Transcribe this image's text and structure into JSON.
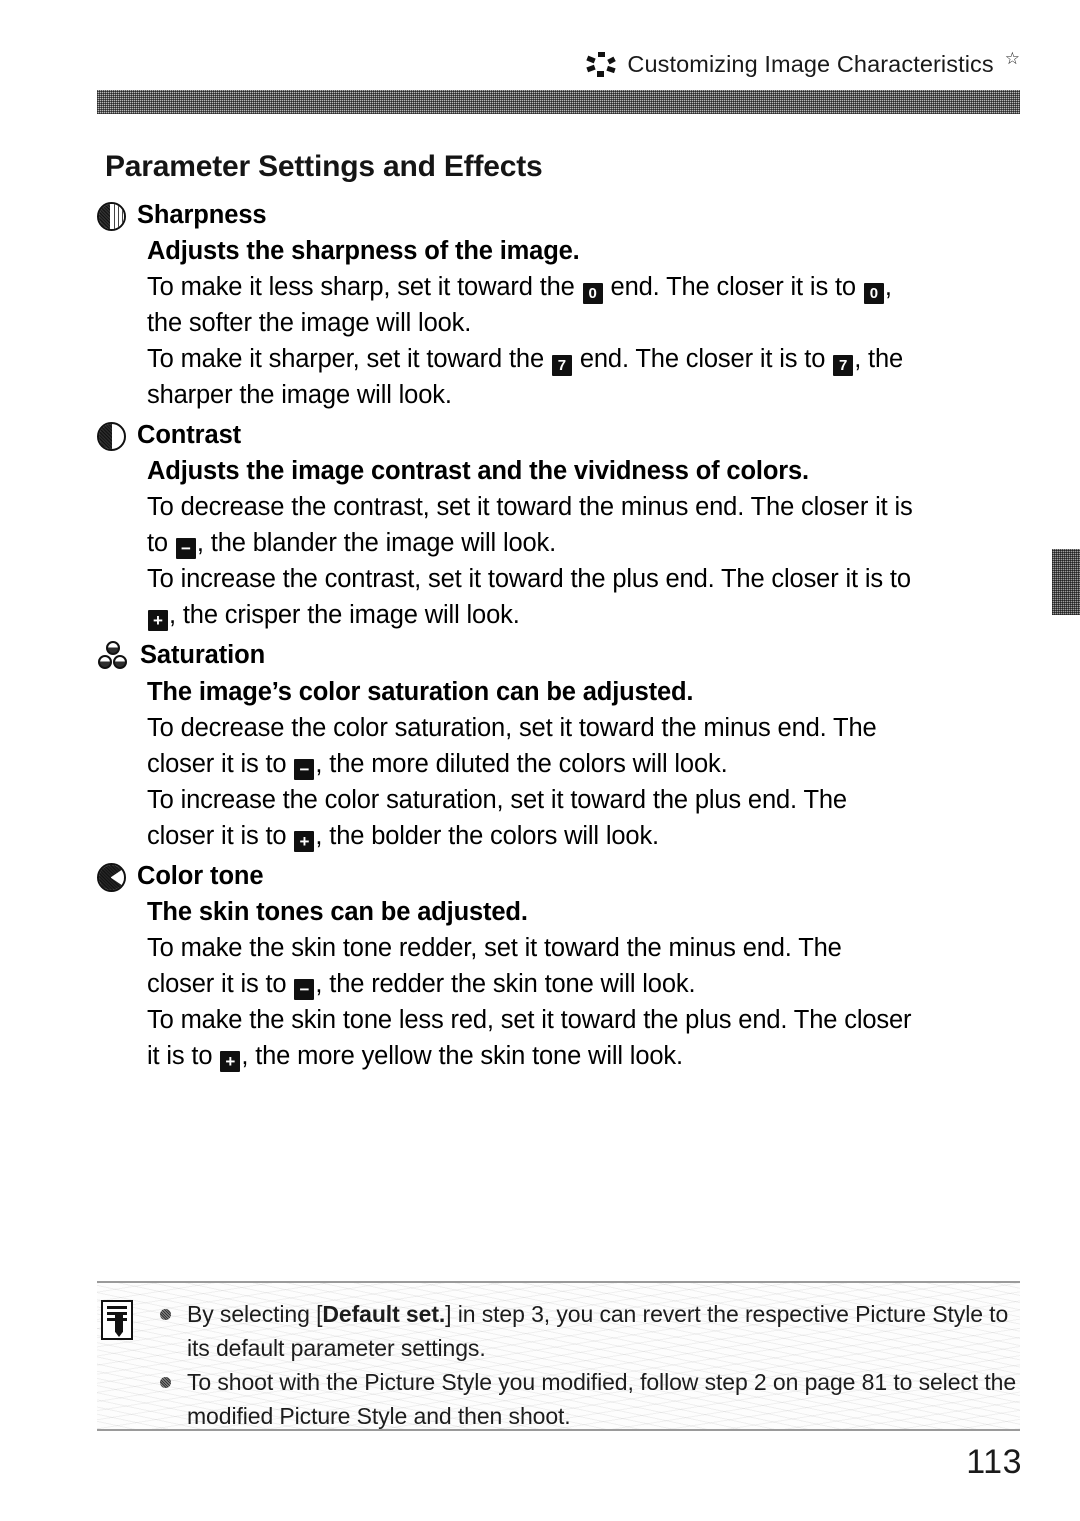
{
  "header": {
    "icon": "picture-style-icon",
    "title": "Customizing Image Characteristics",
    "star": "☆"
  },
  "page": {
    "section_title": "Parameter Settings and Effects",
    "number": "113"
  },
  "glyphs": {
    "zero": "0",
    "seven": "7",
    "minus": "−",
    "plus": "+"
  },
  "parameters": [
    {
      "icon": "sharpness-icon",
      "name": "Sharpness",
      "subtitle": "Adjusts the sharpness of the image.",
      "lines": [
        {
          "parts": [
            {
              "t": "To make it less sharp, set it toward the "
            },
            {
              "k": "0"
            },
            {
              "t": " end. The closer it is to "
            },
            {
              "k": "0"
            },
            {
              "t": ","
            }
          ]
        },
        {
          "parts": [
            {
              "t": "the softer the image will look."
            }
          ]
        },
        {
          "parts": [
            {
              "t": "To make it sharper, set it toward the "
            },
            {
              "k": "7"
            },
            {
              "t": " end. The closer it is to "
            },
            {
              "k": "7"
            },
            {
              "t": ", the"
            }
          ]
        },
        {
          "parts": [
            {
              "t": "sharper the image will look."
            }
          ]
        }
      ]
    },
    {
      "icon": "contrast-icon",
      "name": "Contrast",
      "subtitle": "Adjusts the image contrast and the vividness of colors.",
      "lines": [
        {
          "parts": [
            {
              "t": "To decrease the contrast, set it toward the minus end. The closer it is"
            }
          ]
        },
        {
          "parts": [
            {
              "t": "to "
            },
            {
              "k": "−"
            },
            {
              "t": ", the blander the image will look."
            }
          ]
        },
        {
          "parts": [
            {
              "t": "To increase the contrast, set it toward the plus end. The closer it is to"
            }
          ]
        },
        {
          "parts": [
            {
              "k": "+"
            },
            {
              "t": ", the crisper the image will look."
            }
          ]
        }
      ]
    },
    {
      "icon": "saturation-icon",
      "name": "Saturation",
      "subtitle": "The image’s color saturation can be adjusted.",
      "lines": [
        {
          "parts": [
            {
              "t": "To decrease the color saturation, set it toward the minus end. The"
            }
          ]
        },
        {
          "parts": [
            {
              "t": "closer it is to "
            },
            {
              "k": "−"
            },
            {
              "t": ", the more diluted the colors will look."
            }
          ]
        },
        {
          "parts": [
            {
              "t": "To increase the color saturation, set it toward the plus end. The"
            }
          ]
        },
        {
          "parts": [
            {
              "t": "closer it is to "
            },
            {
              "k": "+"
            },
            {
              "t": ", the bolder the colors will look."
            }
          ]
        }
      ]
    },
    {
      "icon": "color-tone-icon",
      "name": "Color tone",
      "subtitle": "The skin tones can be adjusted.",
      "lines": [
        {
          "parts": [
            {
              "t": "To make the skin tone redder, set it toward the minus end. The"
            }
          ]
        },
        {
          "parts": [
            {
              "t": "closer it is to "
            },
            {
              "k": "−"
            },
            {
              "t": ", the redder the skin tone will look."
            }
          ]
        },
        {
          "parts": [
            {
              "t": "To make the skin tone less red, set it toward the plus end. The closer"
            }
          ]
        },
        {
          "parts": [
            {
              "t": "it is to "
            },
            {
              "k": "+"
            },
            {
              "t": ", the more yellow the skin tone will look."
            }
          ]
        }
      ]
    }
  ],
  "note": {
    "icon": "note-pencil-icon",
    "items": [
      {
        "parts": [
          {
            "t": "By selecting ["
          },
          {
            "b": "Default set."
          },
          {
            "t": "] in step 3, you can revert the respective Picture Style to its default parameter settings."
          }
        ]
      },
      {
        "parts": [
          {
            "t": "To shoot with the Picture Style you modified, follow step 2 on page 81 to select the modified Picture Style and then shoot."
          }
        ]
      }
    ]
  }
}
